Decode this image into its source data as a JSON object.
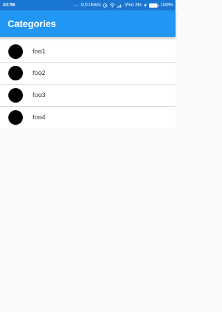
{
  "status_bar": {
    "time": "10:56",
    "dots": "...",
    "network_speed": "0,51KB/s",
    "carrier": "Vivo 3G",
    "battery_percent": "100%",
    "battery_level": 1.0,
    "icons": [
      "alarm-icon",
      "wifi-icon",
      "signal-icon",
      "charging-icon",
      "battery-icon"
    ]
  },
  "app_bar": {
    "title": "Categories",
    "color": "#2196f3"
  },
  "list": {
    "items": [
      {
        "label": "foo1"
      },
      {
        "label": "foo2"
      },
      {
        "label": "foo3"
      },
      {
        "label": "foo4"
      }
    ]
  }
}
